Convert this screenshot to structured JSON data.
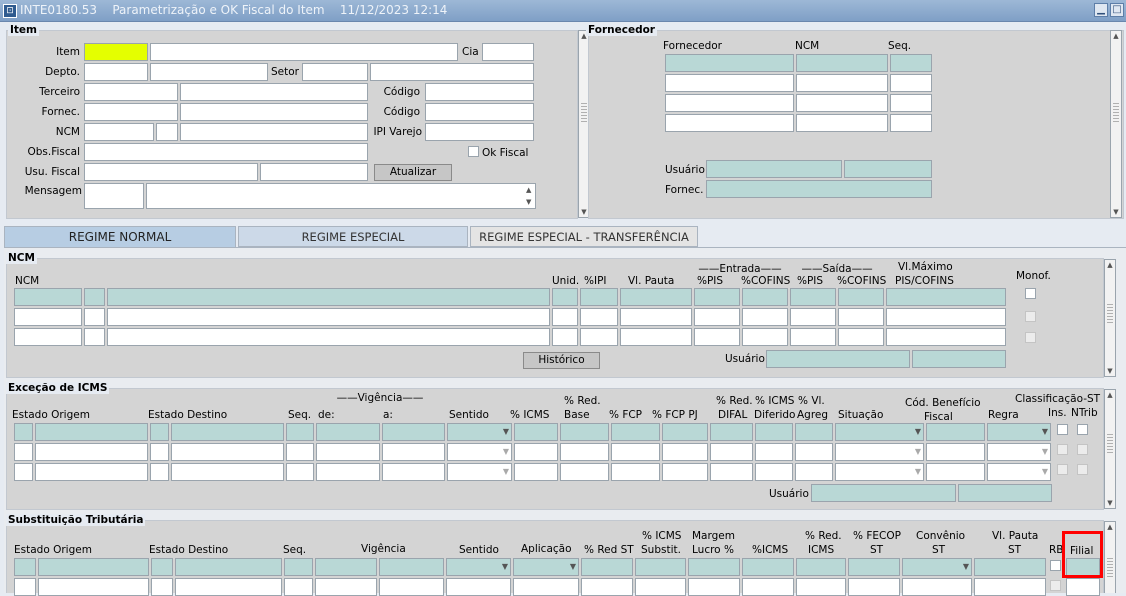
{
  "window": {
    "code": "INTE0180.53",
    "title": "Parametrização e OK Fiscal do Item",
    "datetime": "11/12/2023 12:14",
    "icon": "app-icon",
    "min_icon": "minimize-icon",
    "max_icon": "maximize-icon"
  },
  "item": {
    "title": "Item",
    "labels": {
      "item": "Item",
      "cia": "Cia",
      "depto": "Depto.",
      "setor": "Setor",
      "terceiro": "Terceiro",
      "codigo1": "Código",
      "fornec": "Fornec.",
      "codigo2": "Código",
      "ncm": "NCM",
      "ipi": "IPI Varejo",
      "obs": "Obs.Fiscal",
      "ok": "Ok Fiscal",
      "usu": "Usu. Fiscal",
      "msg": "Mensagem"
    },
    "atualizar": "Atualizar"
  },
  "fornecedor": {
    "title": "Fornecedor",
    "cols": [
      "Fornecedor",
      "NCM",
      "Seq."
    ],
    "usuario": "Usuário",
    "fornec": "Fornec."
  },
  "tabs": [
    "REGIME NORMAL",
    "REGIME ESPECIAL",
    "REGIME ESPECIAL - TRANSFERÊNCIA"
  ],
  "ncm": {
    "title": "NCM",
    "h": {
      "ncm": "NCM",
      "unid": "Unid.",
      "ipi": "%IPI",
      "pauta": "Vl. Pauta",
      "entrada": "Entrada",
      "pis1": "%PIS",
      "cofins1": "%COFINS",
      "saida": "Saída",
      "pis2": "%PIS",
      "cofins2": "%COFINS",
      "vlmax": "Vl.Máximo",
      "piscofins": "PIS/COFINS",
      "monof": "Monof."
    },
    "historico": "Histórico",
    "usuario": "Usuário"
  },
  "excecao": {
    "title": "Exceção de ICMS",
    "h": {
      "origem": "Estado Origem",
      "destino": "Estado Destino",
      "seq": "Seq.",
      "vigencia": "Vigência",
      "de": "de:",
      "a": "a:",
      "sentido": "Sentido",
      "icms": "% ICMS",
      "redbase1": "% Red.",
      "redbase2": "Base",
      "fcp": "% FCP",
      "fcppj": "% FCP PJ",
      "reddifal1": "% Red.",
      "reddifal2": "DIFAL",
      "icmsdif1": "% ICMS",
      "icmsdif2": "Diferido",
      "vlagreg1": "% Vl.",
      "vlagreg2": "Agreg",
      "situacao": "Situação",
      "cben1": "Cód. Benefício",
      "cben2": "Fiscal",
      "regra": "Regra",
      "class": "Classificação-ST",
      "ins": "Ins.",
      "ntrib": "NTrib"
    },
    "usuario": "Usuário"
  },
  "subst": {
    "title": "Substituição Tributária",
    "h": {
      "origem": "Estado Origem",
      "destino": "Estado Destino",
      "seq": "Seq.",
      "vigencia": "Vigência",
      "sentido": "Sentido",
      "aplicacao": "Aplicação",
      "redst": "% Red ST",
      "icmssub1": "% ICMS",
      "icmssub2": "Substit.",
      "margem1": "Margem",
      "margem2": "Lucro %",
      "icms": "%ICMS",
      "redicms1": "% Red.",
      "redicms2": "ICMS",
      "fecop1": "% FECOP",
      "fecop2": "ST",
      "conv1": "Convênio",
      "conv2": "ST",
      "vlpauta1": "Vl. Pauta",
      "vlpauta2": "ST",
      "rb": "RB",
      "filial": "Filial"
    }
  }
}
